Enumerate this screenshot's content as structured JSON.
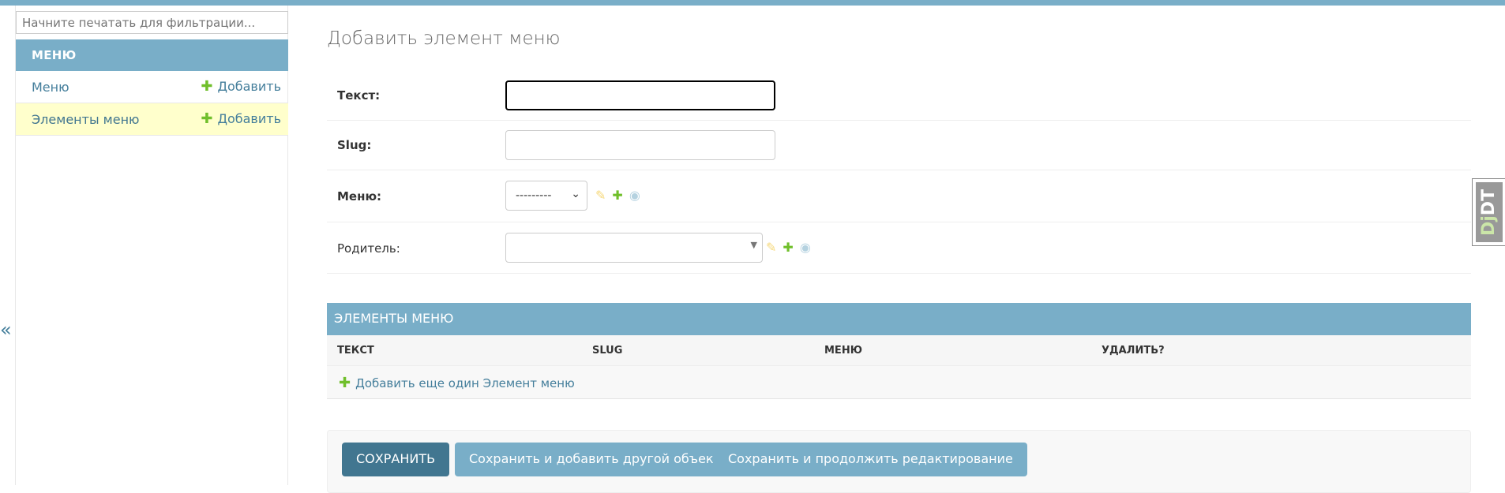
{
  "sidebar": {
    "filter_placeholder": "Начните печатать для фильтрации...",
    "app_caption": "МЕНЮ",
    "models": [
      {
        "name": "Меню",
        "add_label": "Добавить"
      },
      {
        "name": "Элементы меню",
        "add_label": "Добавить"
      }
    ],
    "collapse_icon": "«"
  },
  "main": {
    "title": "Добавить элемент меню",
    "fields": {
      "text_label": "Текст:",
      "slug_label": "Slug:",
      "menu_label": "Меню:",
      "menu_selected": "---------",
      "parent_label": "Родитель:"
    },
    "inline": {
      "caption": "ЭЛЕМЕНТЫ МЕНЮ",
      "columns": [
        "ТЕКСТ",
        "SLUG",
        "МЕНЮ",
        "УДАЛИТЬ?"
      ],
      "add_another": "Добавить еще один Элемент меню"
    },
    "buttons": {
      "save": "СОХРАНИТЬ",
      "save_add_another": "Сохранить и добавить другой объект",
      "save_continue": "Сохранить и продолжить редактирование"
    }
  },
  "djdt": {
    "label_a": "Dj",
    "label_b": "DT"
  },
  "colors": {
    "accent": "#79aec8",
    "primary_button": "#417690",
    "add_green": "#70bf2b",
    "current_row": "#ffffcc"
  }
}
